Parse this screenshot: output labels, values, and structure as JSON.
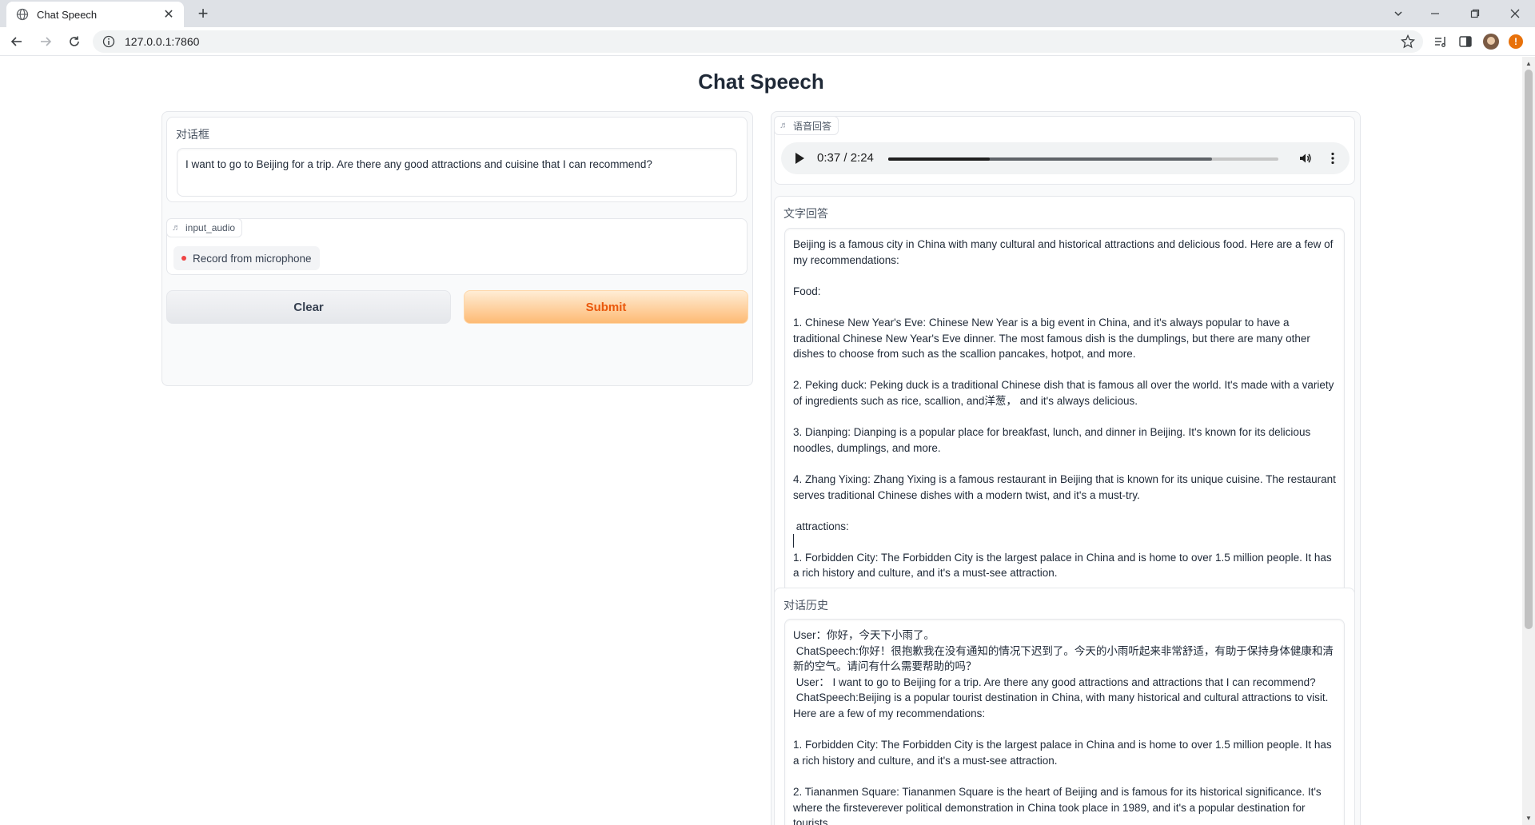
{
  "browser": {
    "tab_title": "Chat Speech",
    "url": "127.0.0.1:7860"
  },
  "app": {
    "title": "Chat Speech"
  },
  "left": {
    "input_label": "对话框",
    "input_value": "I want to go to Beijing for a trip. Are there any good attractions and cuisine that I can recommend?",
    "audio_label": "input_audio",
    "record_label": "Record from microphone",
    "clear_label": "Clear",
    "submit_label": "Submit"
  },
  "right": {
    "audio_label": "语音回答",
    "player": {
      "time_text": "0:37 / 2:24",
      "played_fraction": 0.26,
      "buffered_fraction": 0.83
    },
    "text_label": "文字回答",
    "text_lines": [
      "Beijing is a famous city in China with many cultural and historical attractions and delicious food. Here are a few of my recommendations:",
      "",
      "Food:",
      "",
      "1. Chinese New Year's Eve: Chinese New Year is a big event in China, and it's always popular to have a traditional Chinese New Year's Eve dinner. The most famous dish is the dumplings, but there are many other dishes to choose from such as the scallion pancakes, hotpot, and more.",
      "",
      "2. Peking duck: Peking duck is a traditional Chinese dish that is famous all over the world. It's made with a variety of ingredients such as rice, scallion, and洋葱， and it's always delicious.",
      "",
      "3. Dianping: Dianping is a popular place for breakfast, lunch, and dinner in Beijing. It's known for its delicious noodles, dumplings, and more.",
      "",
      "4. Zhang Yixing: Zhang Yixing is a famous restaurant in Beijing that is known for its unique cuisine. The restaurant serves traditional Chinese dishes with a modern twist, and it's a must-try.",
      "",
      " attractions:",
      "",
      "1. Forbidden City: The Forbidden City is the largest palace in China and is home to over 1.5 million people. It has a rich history and culture, and it's a must-see attraction."
    ],
    "history_label": "对话历史",
    "history_lines": [
      "User：你好，今天下小雨了。",
      " ChatSpeech:你好！很抱歉我在没有通知的情况下迟到了。今天的小雨听起来非常舒适，有助于保持身体健康和清新的空气。请问有什么需要帮助的吗？",
      " User： I want to go to Beijing for a trip. Are there any good attractions and attractions that I can recommend?",
      " ChatSpeech:Beijing is a popular tourist destination in China, with many historical and cultural attractions to visit. Here are a few of my recommendations:",
      "",
      "1. Forbidden City: The Forbidden City is the largest palace in China and is home to over 1.5 million people. It has a rich history and culture, and it's a must-see attraction.",
      "",
      "2. Tiananmen Square: Tiananmen Square is the heart of Beijing and is famous for its historical significance. It's where the firsteverever political demonstration in China took place in 1989, and it's a popular destination for tourists."
    ]
  }
}
